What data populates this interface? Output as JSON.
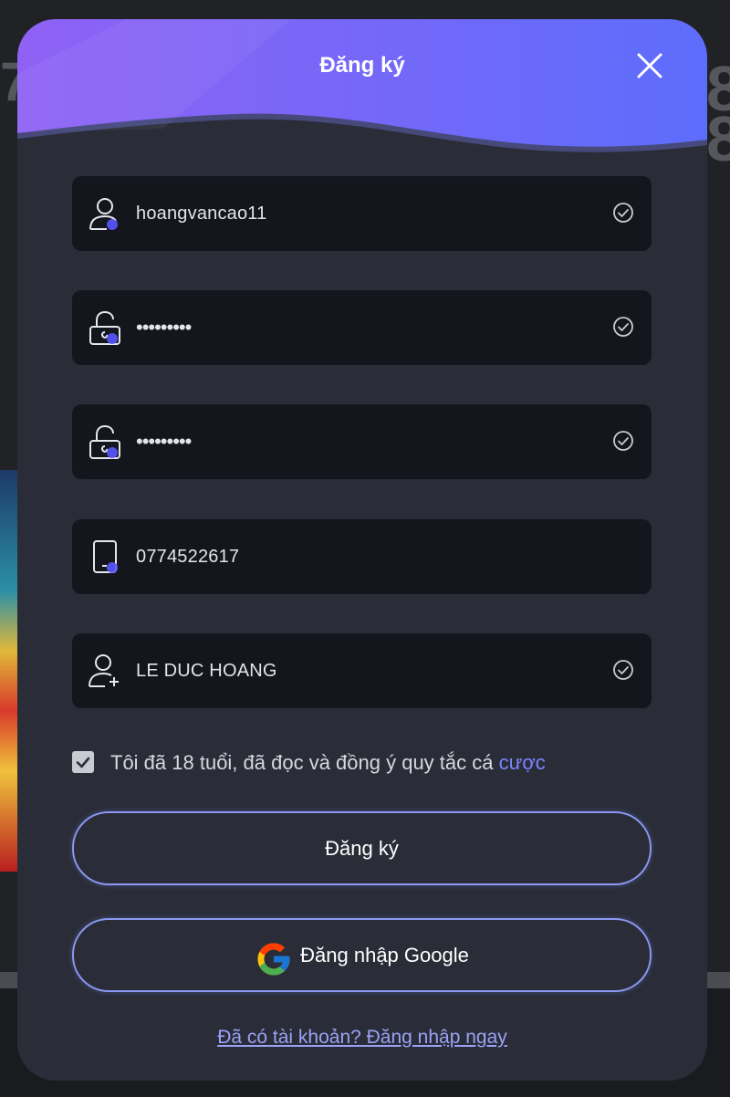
{
  "modal": {
    "title": "Đăng ký",
    "close_icon": "close-icon"
  },
  "fields": {
    "username": {
      "icon": "user-icon",
      "value": "hoangvancao11",
      "status_icon": "check-circle-icon"
    },
    "password": {
      "icon": "lock-icon",
      "value": "•••••••••",
      "status_icon": "check-circle-icon"
    },
    "confirm_password": {
      "icon": "lock-icon",
      "value": "•••••••••",
      "status_icon": "check-circle-icon"
    },
    "phone": {
      "icon": "phone-icon",
      "value": "0774522617"
    },
    "full_name": {
      "icon": "user-add-icon",
      "value": "LE DUC HOANG",
      "status_icon": "check-circle-icon"
    }
  },
  "agreement": {
    "checked": true,
    "text": "Tôi đã 18 tuổi, đã đọc và đồng ý quy tắc cá ",
    "link": "cược"
  },
  "buttons": {
    "register": "Đăng ký",
    "google": "Đăng nhập Google"
  },
  "footer": {
    "login_link": "Đã có tài khoản? Đăng nhập ngay"
  },
  "colors": {
    "header_gradient_start": "#8f62f5",
    "header_gradient_end": "#5d6dfb",
    "modal_bg": "#2a2d38",
    "field_bg": "#13161d",
    "accent": "#7b83ff"
  }
}
